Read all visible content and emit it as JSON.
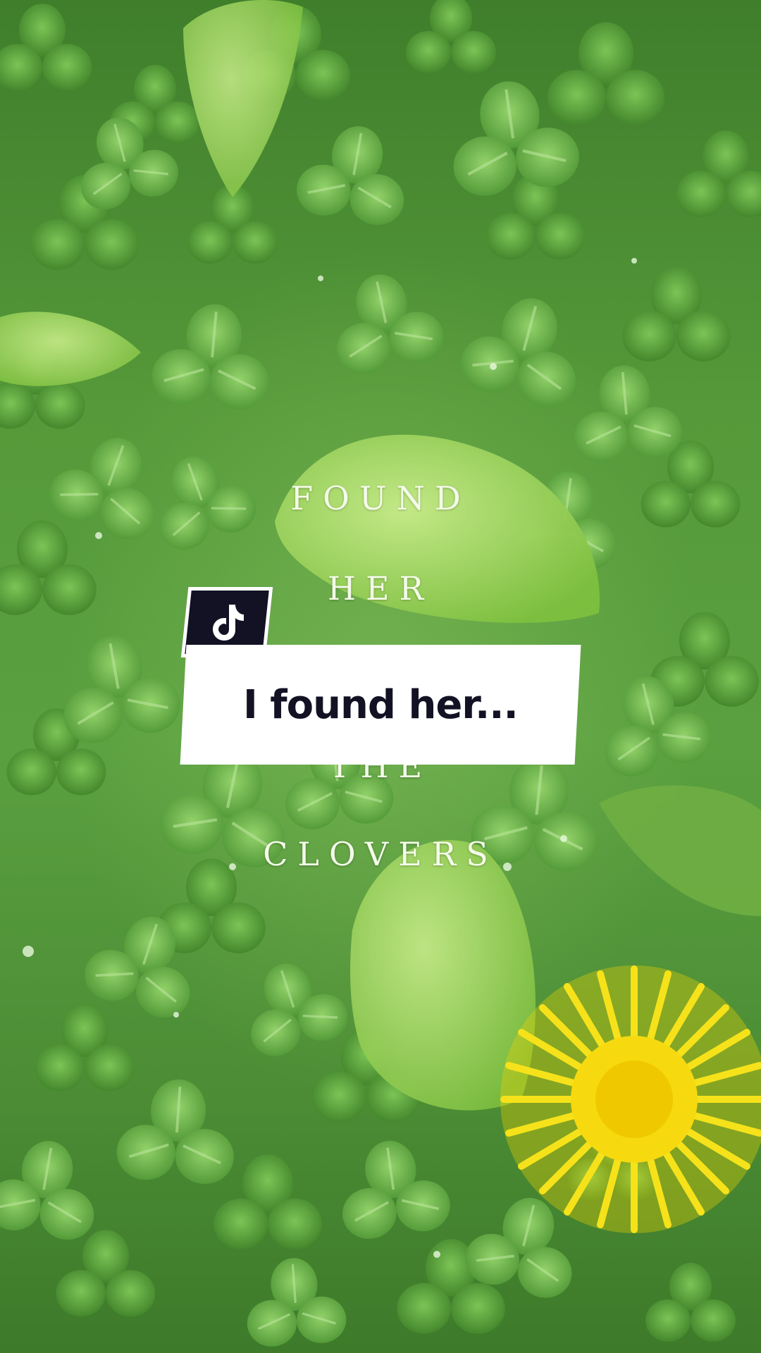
{
  "overlay": {
    "lines": [
      "FOUND",
      "HER",
      "THE",
      "CLOVERS"
    ]
  },
  "watermark": {
    "icon": "tiktok-logo-icon"
  },
  "caption": {
    "text": "I found her..."
  },
  "colors": {
    "clover_green": "#5aa040",
    "dandelion_yellow": "#f6e21a",
    "caption_bg": "#ffffff",
    "caption_text": "#121224"
  }
}
